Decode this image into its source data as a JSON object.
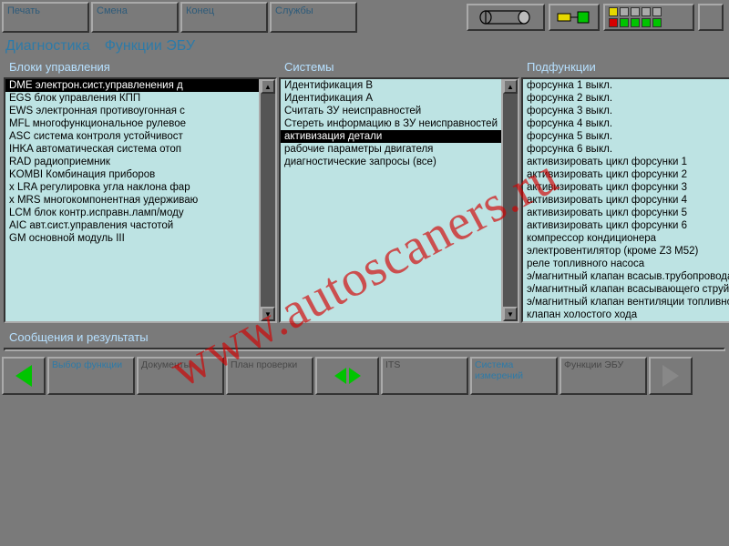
{
  "topbar": {
    "buttons": [
      "Печать",
      "Смена",
      "Конец",
      "Службы"
    ]
  },
  "title": {
    "a": "Диагностика",
    "b": "Функции ЭБУ"
  },
  "panels": {
    "blocks": {
      "title": "Блоки управления",
      "items": [
        {
          "mark": "",
          "t": "DME электрон.сист.управленения д",
          "sel": true
        },
        {
          "mark": "",
          "t": "EGS блок управления КПП"
        },
        {
          "mark": "",
          "t": "EWS электронная противоугонная с"
        },
        {
          "mark": "",
          "t": "MFL многофункциональное рулевое"
        },
        {
          "mark": "",
          "t": "ASC система контроля устойчивост"
        },
        {
          "mark": "",
          "t": "IHKA автоматическая система отоп"
        },
        {
          "mark": "",
          "t": "RAD радиоприемник"
        },
        {
          "mark": "",
          "t": "KOMBI Комбинация приборов"
        },
        {
          "mark": "x",
          "t": "LRA регулировка угла наклона фар"
        },
        {
          "mark": "x",
          "t": "MRS многокомпонентная удерживаю"
        },
        {
          "mark": "",
          "t": "LCM блок контр.исправн.ламп/моду"
        },
        {
          "mark": "",
          "t": "AIC авт.сист.управления частотой"
        },
        {
          "mark": "",
          "t": "GM основной модуль III"
        }
      ]
    },
    "systems": {
      "title": "Системы",
      "items": [
        {
          "t": "Идентификация B"
        },
        {
          "t": "Идентификация A"
        },
        {
          "t": "Считать ЗУ неисправностей"
        },
        {
          "t": "Стереть информацию в ЗУ неисправностей"
        },
        {
          "t": "активизация детали",
          "sel": true
        },
        {
          "t": "рабочие параметры двигателя"
        },
        {
          "t": "диагностические запросы (все)"
        }
      ]
    },
    "subfn": {
      "title": "Подфункции",
      "items": [
        {
          "t": "форсунка 1 выкл."
        },
        {
          "t": "форсунка 2 выкл."
        },
        {
          "t": "форсунка 3 выкл."
        },
        {
          "t": "форсунка 4 выкл."
        },
        {
          "t": "форсунка 5 выкл."
        },
        {
          "t": "форсунка 6 выкл."
        },
        {
          "t": "активизировать цикл форсунки 1"
        },
        {
          "t": "активизировать цикл форсунки 2"
        },
        {
          "t": "активизировать цикл форсунки 3"
        },
        {
          "t": "активизировать цикл форсунки 4"
        },
        {
          "t": "активизировать цикл форсунки 5"
        },
        {
          "t": "активизировать цикл форсунки 6"
        },
        {
          "t": "компрессор кондиционера"
        },
        {
          "t": "электровентилятор (кроме Z3 M52)"
        },
        {
          "t": "реле топливного насоса"
        },
        {
          "t": "э/магнитный клапан всасыв.трубопровода (D"
        },
        {
          "t": "э/магнитный клапан всасывающего струйн.на"
        },
        {
          "t": "э/магнитный клапан вентиляции топливного б"
        },
        {
          "t": "клапан холостого хода"
        }
      ]
    }
  },
  "messages": {
    "title": "Сообщения и результаты"
  },
  "bottom": {
    "b1": "Выбор функции",
    "b2": "Документы",
    "b3": "План проверки",
    "b4": "ITS",
    "b5": "Система измерений",
    "b6": "Функции ЭБУ"
  },
  "watermark": "www.autoscaners.ru"
}
